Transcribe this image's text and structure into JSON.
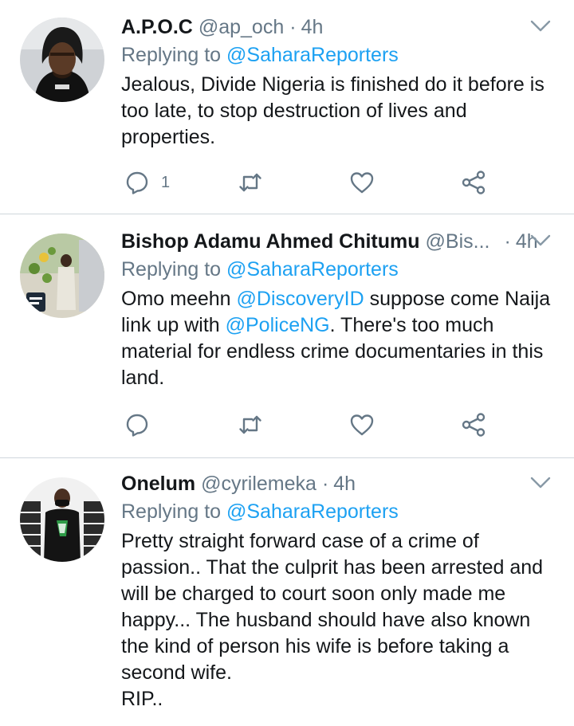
{
  "tweets": [
    {
      "name": "A.P.O.C",
      "handle": "@ap_och",
      "time": "4h",
      "replying_prefix": "Replying to",
      "replying_to": "@SaharaReporters",
      "text_lines": [
        "Jealous, Divide Nigeria is finished do it before is",
        "too late, to stop destruction of lives and",
        "properties."
      ],
      "reply_count": "1"
    },
    {
      "name": "Bishop Adamu Ahmed Chitumu",
      "handle": "@Bis...",
      "time": "4h",
      "replying_prefix": "Replying to",
      "replying_to": "@SaharaReporters",
      "text_parts": {
        "l1a": "Omo meehn ",
        "l1m": "@DiscoveryID",
        "l1b": " suppose come Naija",
        "l2a": "link up with ",
        "l2m": "@PoliceNG",
        "l2b": ". There's too much",
        "l3": "material for endless crime documentaries in this",
        "l4": "land."
      },
      "reply_count": ""
    },
    {
      "name": "Onelum",
      "handle": "@cyrilemeka",
      "time": "4h",
      "replying_prefix": "Replying to",
      "replying_to": "@SaharaReporters",
      "text_lines": [
        "Pretty straight forward case of a crime of",
        "passion.. That the culprit has been arrested and",
        "will be charged to court soon only made me",
        "happy... The husband should have also known",
        "the kind of person his wife is before taking a",
        "second wife.",
        "RIP.."
      ]
    }
  ],
  "separator": "·",
  "icons": {
    "reply": "reply-icon",
    "retweet": "retweet-icon",
    "like": "heart-icon",
    "share": "share-icon",
    "menu": "chevron-down-icon"
  },
  "colors": {
    "link": "#1da1f2",
    "muted": "#657786",
    "text": "#14171a",
    "divider": "#cfd6dc"
  }
}
